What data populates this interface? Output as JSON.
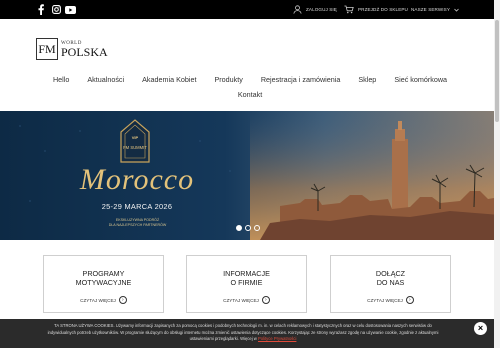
{
  "topbar": {
    "social": [
      {
        "icon": "facebook-icon"
      },
      {
        "icon": "instagram-icon"
      },
      {
        "icon": "youtube-icon"
      }
    ],
    "login_label": "ZALOGUJ SIĘ",
    "shop_label": "PRZEJDŹ DO SKLEPU",
    "services_label": "NASZE SERWISY"
  },
  "logo": {
    "mark": "FM",
    "world": "WORLD",
    "polska": "POLSKA"
  },
  "nav": {
    "items": [
      "Hello",
      "Aktualności",
      "Akademia Kobiet",
      "Produkty",
      "Rejestracja i zamówienia",
      "Sklep",
      "Sieć komórkowa",
      "Kontakt"
    ]
  },
  "hero": {
    "badge_line1": "VIP",
    "badge_line2": "FM SUMMIT",
    "title": "Morocco",
    "date": "25-29 MARCA 2026",
    "subtitle_line1": "EKSKLUZYWNA PODRÓŻ",
    "subtitle_line2": "DLA NAJLEPSZYCH PARTNERÓW",
    "slides": [
      true,
      false,
      false
    ]
  },
  "cards": [
    {
      "title_line1": "PROGRAMY",
      "title_line2": "MOTYWACYJNE",
      "more": "CZYTAJ WIĘCEJ"
    },
    {
      "title_line1": "INFORMACJE",
      "title_line2": "O FIRMIE",
      "more": "CZYTAJ WIĘCEJ"
    },
    {
      "title_line1": "DOŁĄCZ",
      "title_line2": "DO NAS",
      "more": "CZYTAJ WIĘCEJ"
    }
  ],
  "cookie": {
    "line1": "TA STRONA UŻYWA COOKIES. Używamy informacji zapisanych za pomocą cookies i podobnych technologii m. in. w celach reklamowych i statystycznych oraz w celu dostosowania naszych serwisów do",
    "line2": "indywidualnych potrzeb użytkowników. W programie służącym do obsługi internetu można zmienić ustawienia dotyczące cookies. Korzystając ze strony wyrażasz zgodę na używanie cookie, zgodnie z aktualnymi",
    "line3_prefix": "ustawieniami przeglądarki. Więcej w",
    "link": "Polityce Prywatności",
    "close": "×"
  }
}
